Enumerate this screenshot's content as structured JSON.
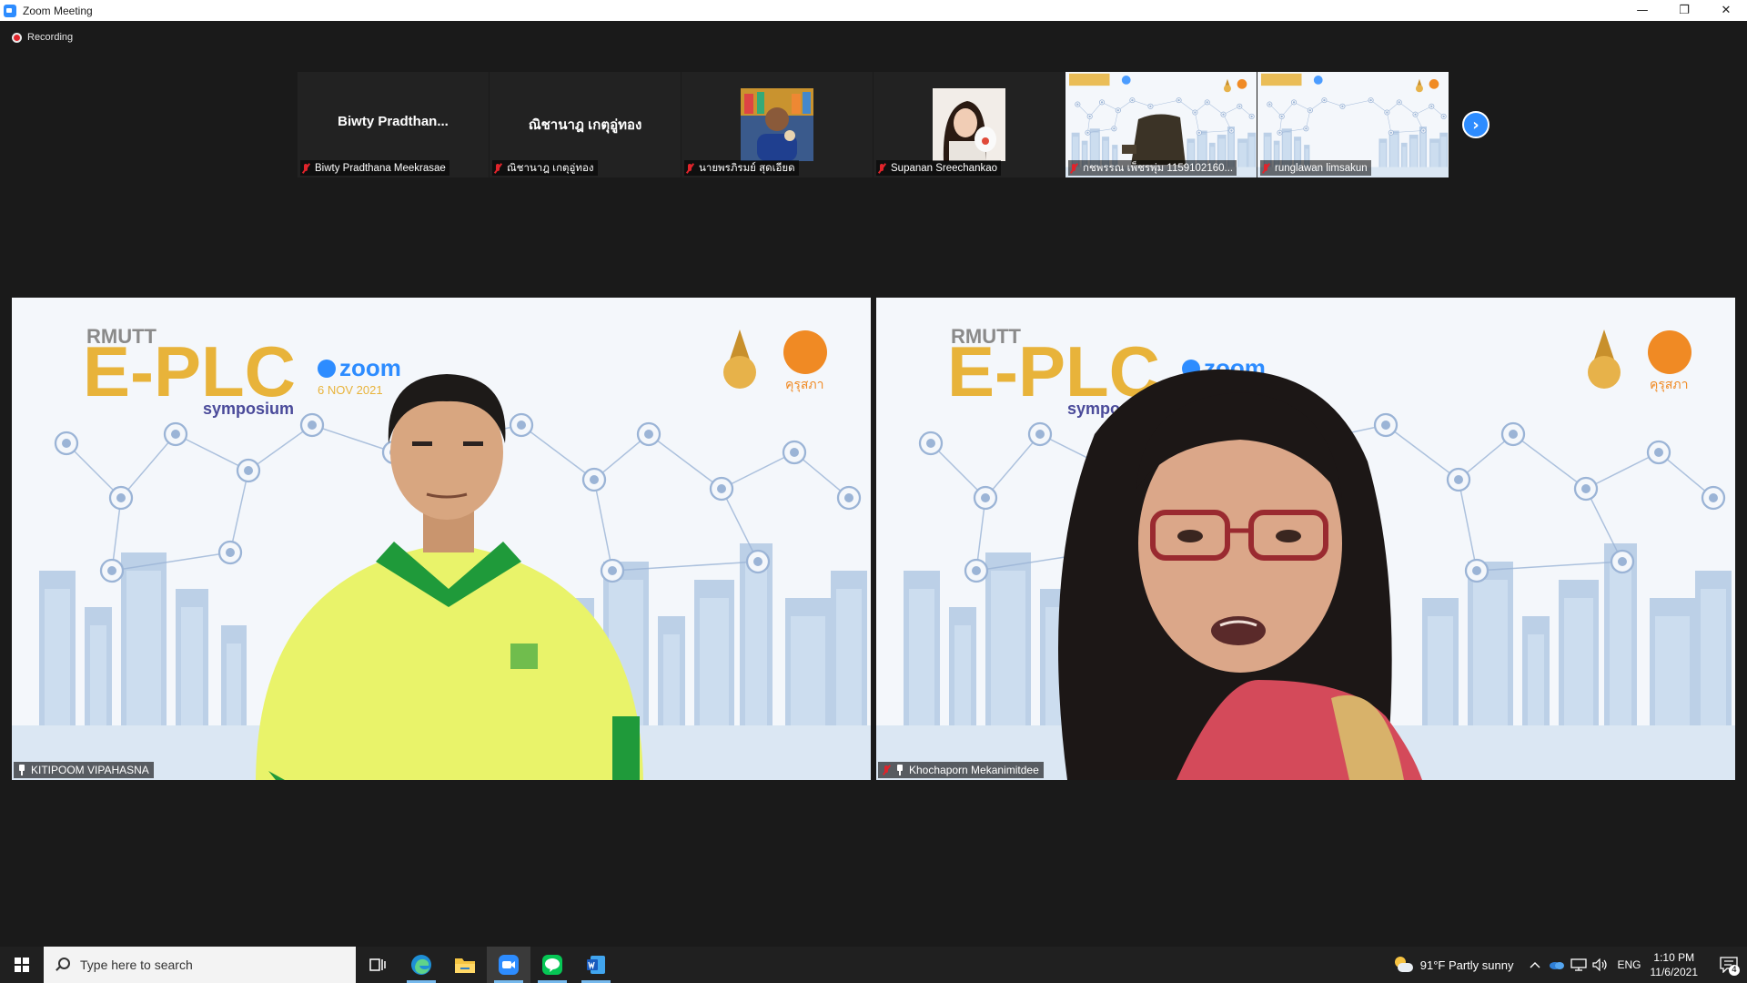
{
  "window": {
    "title": "Zoom Meeting",
    "minimize": "—",
    "restore": "❐",
    "close": "✕"
  },
  "recording": {
    "label": "Recording"
  },
  "thumbnails": [
    {
      "display_name": "Biwty  Pradthan...",
      "label": "Biwty Pradthana Meekrasae",
      "muted": true
    },
    {
      "display_name": "ณิชานาฎ เกตุอู่ทอง",
      "label": "ณิชานาฎ เกตุอู่ทอง",
      "muted": true
    },
    {
      "display_name": "",
      "label": "นายพรภิรมย์ สุดเอียด",
      "muted": true
    },
    {
      "display_name": "",
      "label": "Supanan Sreechankao",
      "muted": true
    },
    {
      "display_name": "",
      "label": "กชพรรณ เพ็ชรพุ่ม 1159102160...",
      "muted": true
    },
    {
      "display_name": "",
      "label": "runglawan limsakun",
      "muted": true
    }
  ],
  "next_page": "›",
  "speakers": [
    {
      "name": "KITIPOOM VIPAHASNA",
      "pinned": true,
      "muted": false
    },
    {
      "name": "Khochaporn Mekanimitdee",
      "pinned": true,
      "muted": true
    }
  ],
  "background": {
    "brand": "RMUTT",
    "title": "E-PLC",
    "zoom": "zoom",
    "date": "6 NOV 2021",
    "subtitle": "symposium",
    "logo_text": "คุรุสภา",
    "accent": "#e8b33a",
    "orange": "#f08a24",
    "line_color": "#9bb4d6"
  },
  "taskbar": {
    "search_placeholder": "Type here to search",
    "weather": "91°F  Partly sunny",
    "lang": "ENG",
    "time": "1:10 PM",
    "date": "11/6/2021",
    "notifications": "4"
  }
}
